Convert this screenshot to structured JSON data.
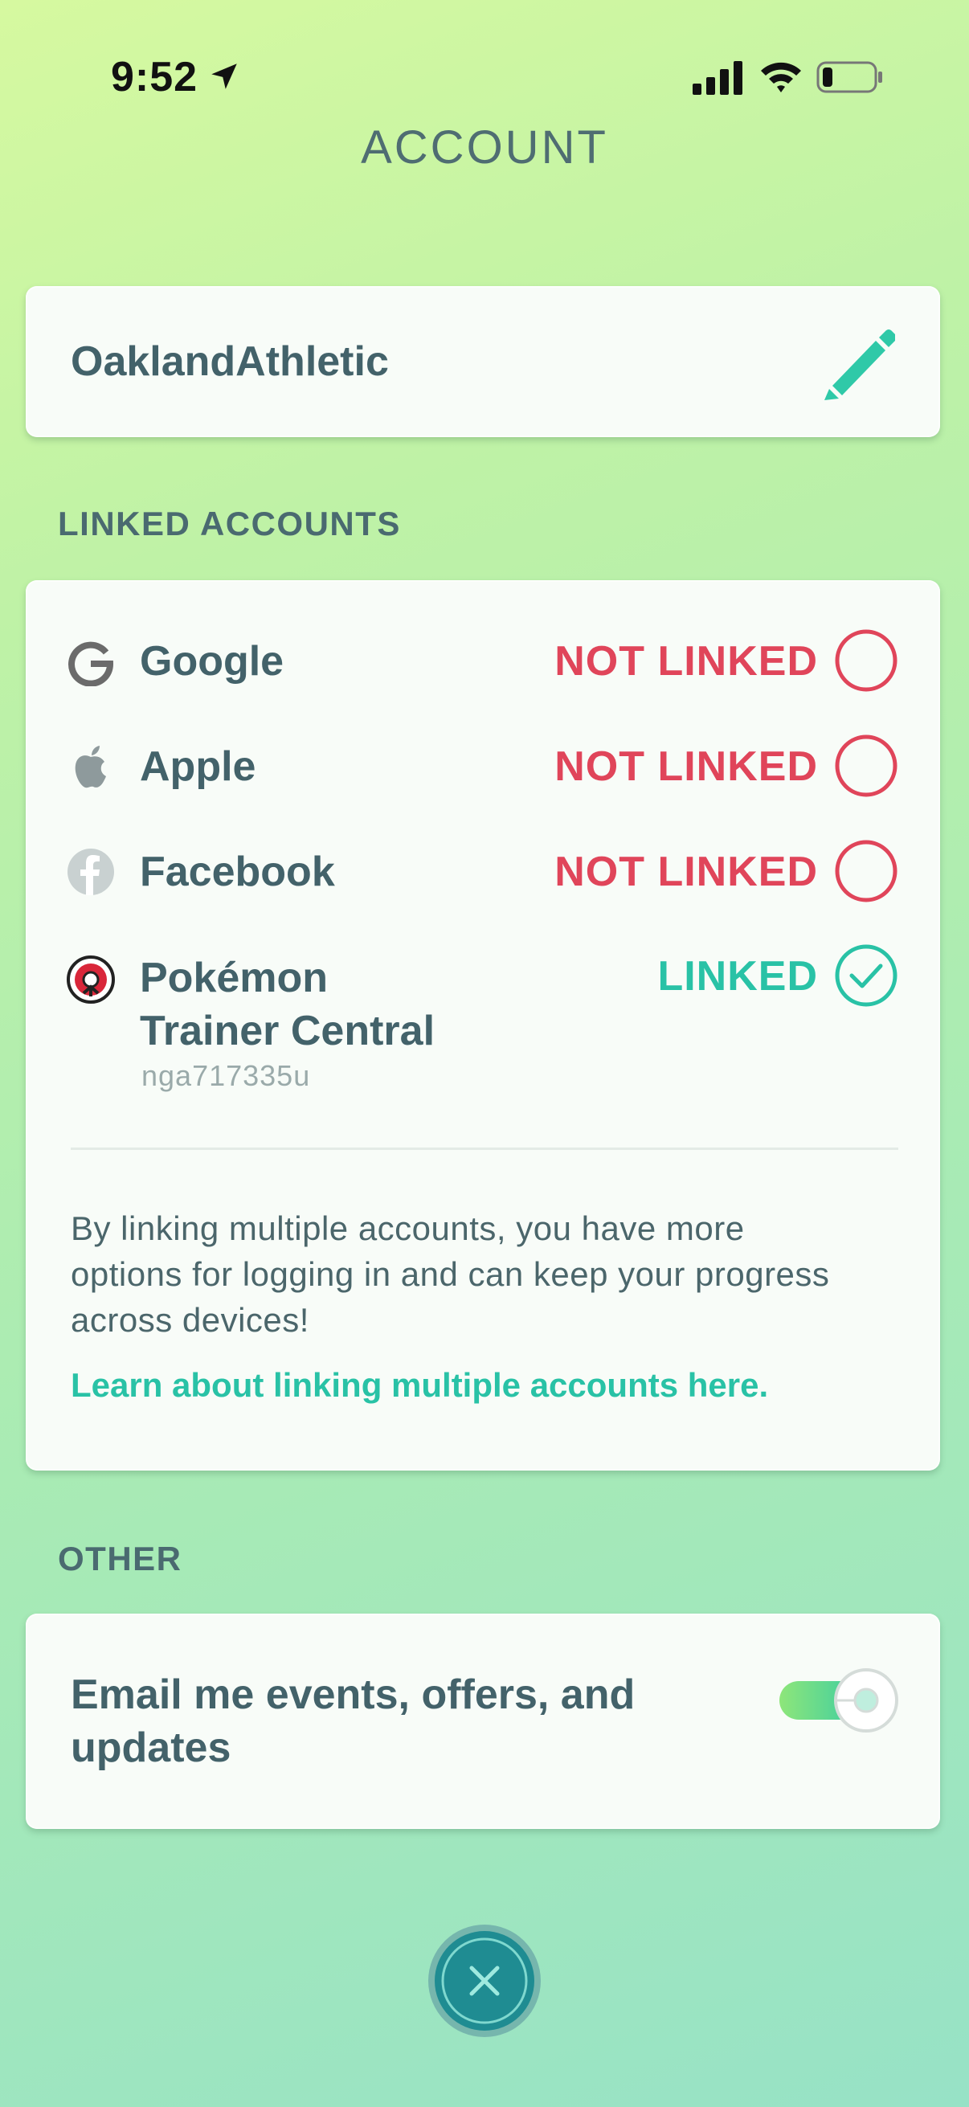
{
  "status_bar": {
    "time": "9:52"
  },
  "header": {
    "title": "ACCOUNT"
  },
  "profile": {
    "username": "OaklandAthletic",
    "edit_icon": "pencil-icon"
  },
  "linked_accounts": {
    "section_label": "LINKED ACCOUNTS",
    "items": [
      {
        "name": "Google",
        "status": "NOT LINKED",
        "linked": false,
        "icon": "google-icon"
      },
      {
        "name": "Apple",
        "status": "NOT LINKED",
        "linked": false,
        "icon": "apple-icon"
      },
      {
        "name": "Facebook",
        "status": "NOT LINKED",
        "linked": false,
        "icon": "facebook-icon"
      },
      {
        "name_line1": "Pokémon",
        "name_line2": "Trainer Central",
        "status": "LINKED",
        "linked": true,
        "username": "nga717335u",
        "icon": "pokeball-icon"
      }
    ],
    "description": "By linking multiple accounts, you have more options for logging in and can keep your progress across devices!",
    "learn_link": "Learn about linking multiple accounts here."
  },
  "other": {
    "section_label": "OTHER",
    "email_label": "Email me events, offers, and updates",
    "email_toggle_on": true
  },
  "colors": {
    "accent": "#29c2a6",
    "not_linked": "#e0455a",
    "text": "#43626a"
  }
}
